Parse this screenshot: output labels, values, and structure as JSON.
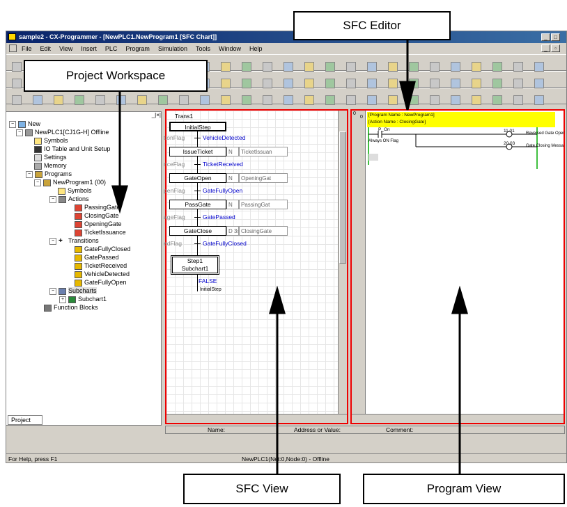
{
  "window": {
    "title": "sample2 - CX-Programmer - [NewPLC1.NewProgram1 [SFC Chart]]",
    "menu": [
      "File",
      "Edit",
      "View",
      "Insert",
      "PLC",
      "Program",
      "Simulation",
      "Tools",
      "Window",
      "Help"
    ]
  },
  "callouts": {
    "sfc_editor": "SFC Editor",
    "project_workspace": "Project Workspace",
    "sfc_view": "SFC View",
    "program_view": "Program View"
  },
  "tree": {
    "root": "New",
    "plc": "NewPLC1[CJ1G-H] Offline",
    "symbols": "Symbols",
    "io_table": "IO Table and Unit Setup",
    "settings": "Settings",
    "memory": "Memory",
    "programs": "Programs",
    "program": "NewProgram1 (00)",
    "prog_symbols": "Symbols",
    "actions": "Actions",
    "action_items": [
      "PassingGate",
      "ClosingGate",
      "OpeningGate",
      "TicketIssuance"
    ],
    "transitions": "Transitions",
    "transition_items": [
      "GateFullyClosed",
      "GatePassed",
      "TicketReceived",
      "VehicleDetected",
      "GateFullyOpen"
    ],
    "subcharts": "Subcharts",
    "subchart_item": "Subchart1",
    "function_blocks": "Function Blocks",
    "tab": "Project"
  },
  "sfc": {
    "trans_top": "Trans1",
    "initial_step": "InitialStep",
    "rows": [
      {
        "flag": "tionFlag",
        "trans": "VehicleDetected",
        "step": "IssueTicket",
        "qual": "N",
        "action": "TicketIssuan"
      },
      {
        "flag": "nceFlag",
        "trans": "TicketReceived",
        "step": "GateOpen",
        "qual": "N",
        "action": "OpeningGat"
      },
      {
        "flag": "penFlag",
        "trans": "GateFullyOpen",
        "step": "PassGate",
        "qual": "N",
        "action": "PassingGat"
      },
      {
        "flag": "ageFlag",
        "trans": "GatePassed",
        "step": "GateClose",
        "qual": "D  3s",
        "action": "ClosingGate"
      },
      {
        "flag": "edFlag",
        "trans": "GateFullyClosed",
        "step": "",
        "qual": "",
        "action": ""
      }
    ],
    "subchart_step": "Step1",
    "subchart_name": "Subchart1",
    "false_label": "FALSE",
    "jump_label": "InitialStep"
  },
  "program": {
    "rung_no": "0",
    "rung_addr": "0",
    "header1": "[Program Name : NewProgram1]",
    "header2": "[Action Name : ClosingGate]",
    "contact": "P_On",
    "contact_comment": "Always ON Flag",
    "coil1": "11.01",
    "coil1_comment": "Reversed Gate Oper",
    "coil2": "20.03",
    "coil2_comment": "Gate Closing Messa"
  },
  "bottom": {
    "name_label": "Name:",
    "address_label": "Address or Value:",
    "comment_label": "Comment:"
  },
  "statusbar": {
    "help": "For Help, press F1",
    "connection": "NewPLC1(Net:0,Node:0) - Offline"
  },
  "colors": {
    "highlight_border": "#e00000",
    "program_header": "#ffff00",
    "title_bar": "#0a246a"
  }
}
